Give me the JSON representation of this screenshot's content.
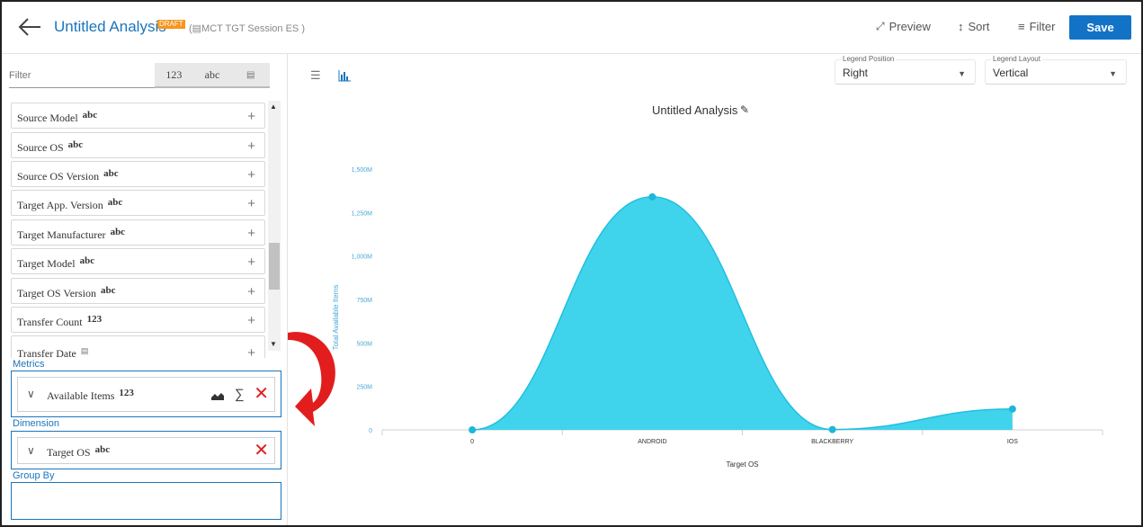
{
  "header": {
    "title": "Untitled Analysis",
    "draft_badge": "DRAFT",
    "session": "(▤MCT TGT Session ES )",
    "preview_label": "Preview",
    "sort_label": "Sort",
    "filter_label": "Filter",
    "save_label": "Save"
  },
  "sidebar": {
    "filter_placeholder": "Filter",
    "type_tabs": [
      "123",
      "abc",
      "▤"
    ],
    "fields": [
      {
        "label": "Source Model",
        "type": "abc"
      },
      {
        "label": "Source OS",
        "type": "abc"
      },
      {
        "label": "Source OS Version",
        "type": "abc"
      },
      {
        "label": "Target App. Version",
        "type": "abc"
      },
      {
        "label": "Target Manufacturer",
        "type": "abc"
      },
      {
        "label": "Target Model",
        "type": "abc"
      },
      {
        "label": "Target OS Version",
        "type": "abc"
      },
      {
        "label": "Transfer Count",
        "type": "123"
      },
      {
        "label": "Transfer Date",
        "type": "▤"
      }
    ],
    "metrics_label": "Metrics",
    "metric": {
      "label": "Available Items",
      "type": "123"
    },
    "dimension_label": "Dimension",
    "dimension": {
      "label": "Target OS",
      "type": "abc"
    },
    "group_by_label": "Group By"
  },
  "controls": {
    "legend_position_label": "Legend Position",
    "legend_position_value": "Right",
    "legend_layout_label": "Legend Layout",
    "legend_layout_value": "Vertical"
  },
  "colors": {
    "accent": "#1b75bc",
    "save": "#1273c6",
    "area": "#40d3ec",
    "remove": "#e02020",
    "arrow": "#e21d1d"
  },
  "chart_data": {
    "type": "area",
    "title": "Untitled Analysis",
    "xlabel": "Target OS",
    "ylabel": "Total Available Items",
    "categories": [
      "0",
      "ANDROID",
      "BLACKBERRY",
      "IOS"
    ],
    "values": [
      0,
      1340,
      2,
      120
    ],
    "y_tick_labels": [
      "0",
      "250M",
      "500M",
      "750M",
      "1,000M",
      "1,250M",
      "1,500M"
    ],
    "ylim": [
      0,
      1500
    ],
    "unit": "M",
    "grid": false
  }
}
